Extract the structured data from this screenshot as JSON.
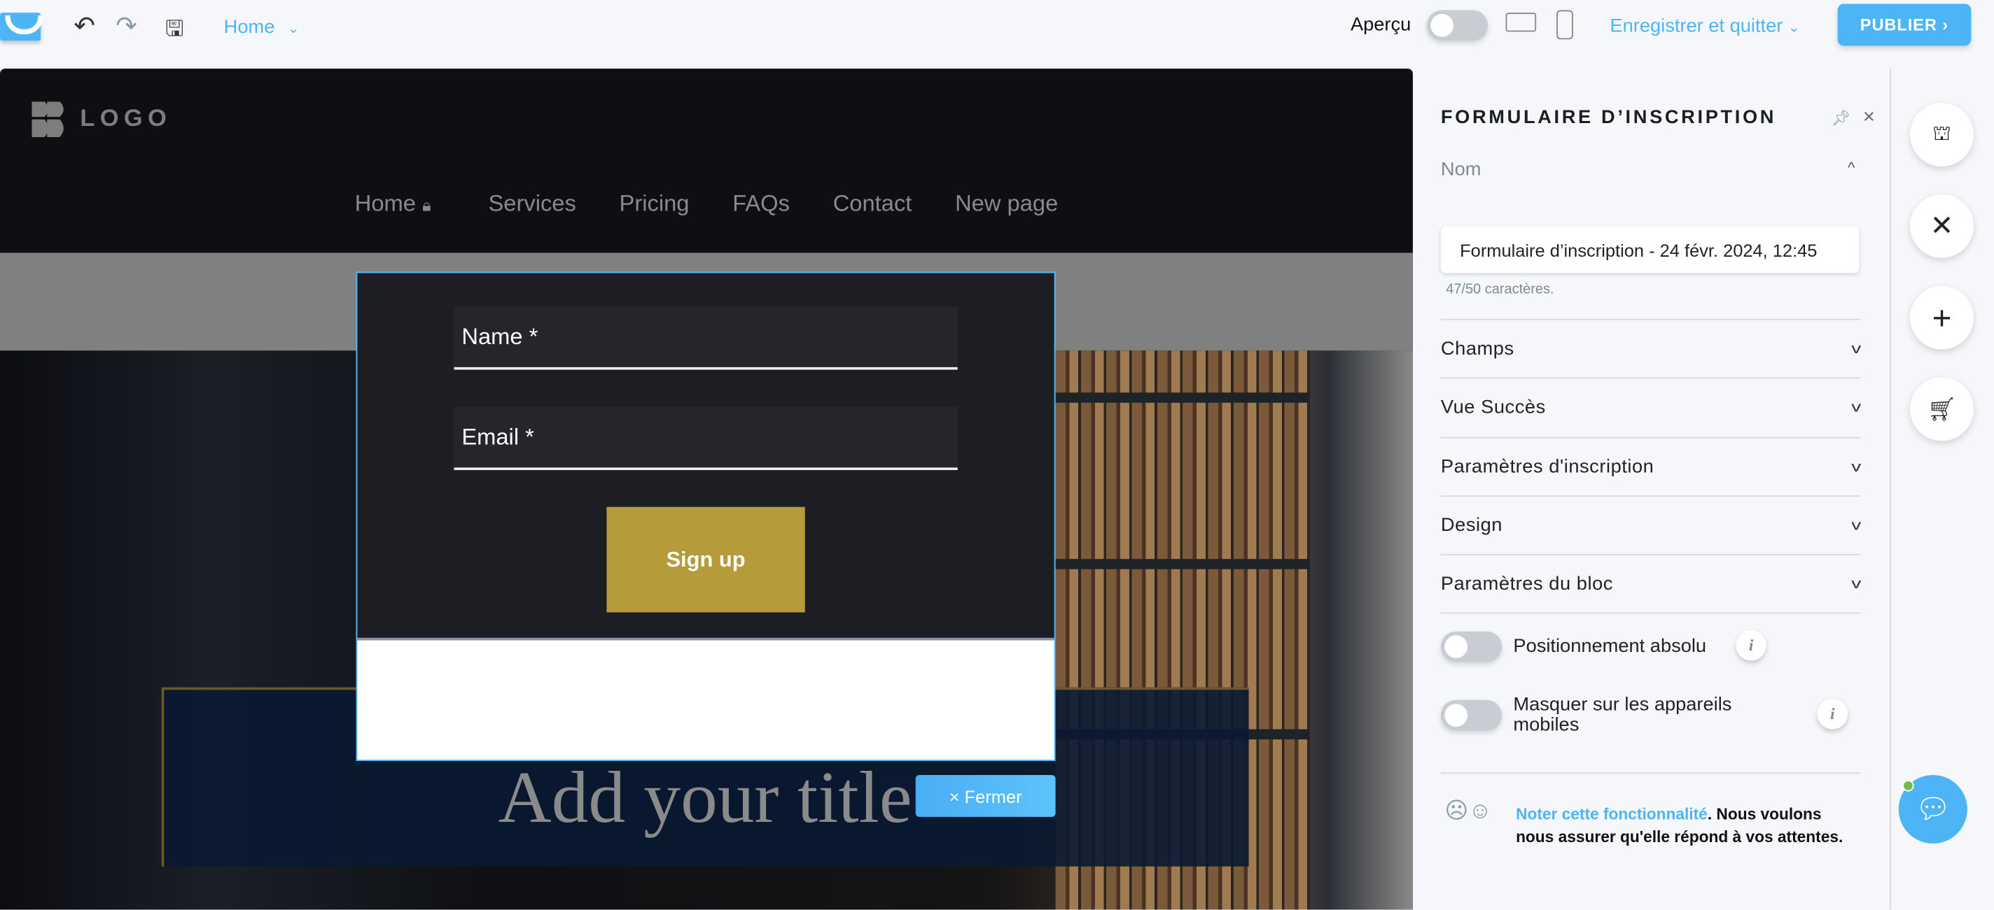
{
  "topbar": {
    "page_selector": "Home",
    "preview_label": "Aperçu",
    "preview_on": false,
    "save_quit": "Enregistrer et quitter",
    "publish": "PUBLIER"
  },
  "site": {
    "logo_text": "LOGO",
    "nav": [
      "Home",
      "Services",
      "Pricing",
      "FAQs",
      "Contact",
      "New page"
    ],
    "title": "Add your title"
  },
  "form": {
    "name_placeholder": "Name *",
    "email_placeholder": "Email *",
    "submit": "Sign up",
    "close": "Fermer"
  },
  "panel": {
    "title": "FORMULAIRE D’INSCRIPTION",
    "name_label": "Nom",
    "name_value": "Formulaire d’inscription - 24 févr. 2024, 12:45",
    "char_count": "47/50 caractères.",
    "sections": [
      "Champs",
      "Vue Succès",
      "Paramètres d'inscription",
      "Design",
      "Paramètres du bloc"
    ],
    "toggles": [
      {
        "label": "Positionnement absolu",
        "on": false
      },
      {
        "label": "Masquer sur les appareils mobiles",
        "on": false
      }
    ],
    "feedback_link": "Noter cette fonctionnalité",
    "feedback_text": ". Nous voulons nous assurer qu'elle répond à vos attentes."
  },
  "colors": {
    "accent": "#4db5f5",
    "button": "#b59b3a"
  }
}
